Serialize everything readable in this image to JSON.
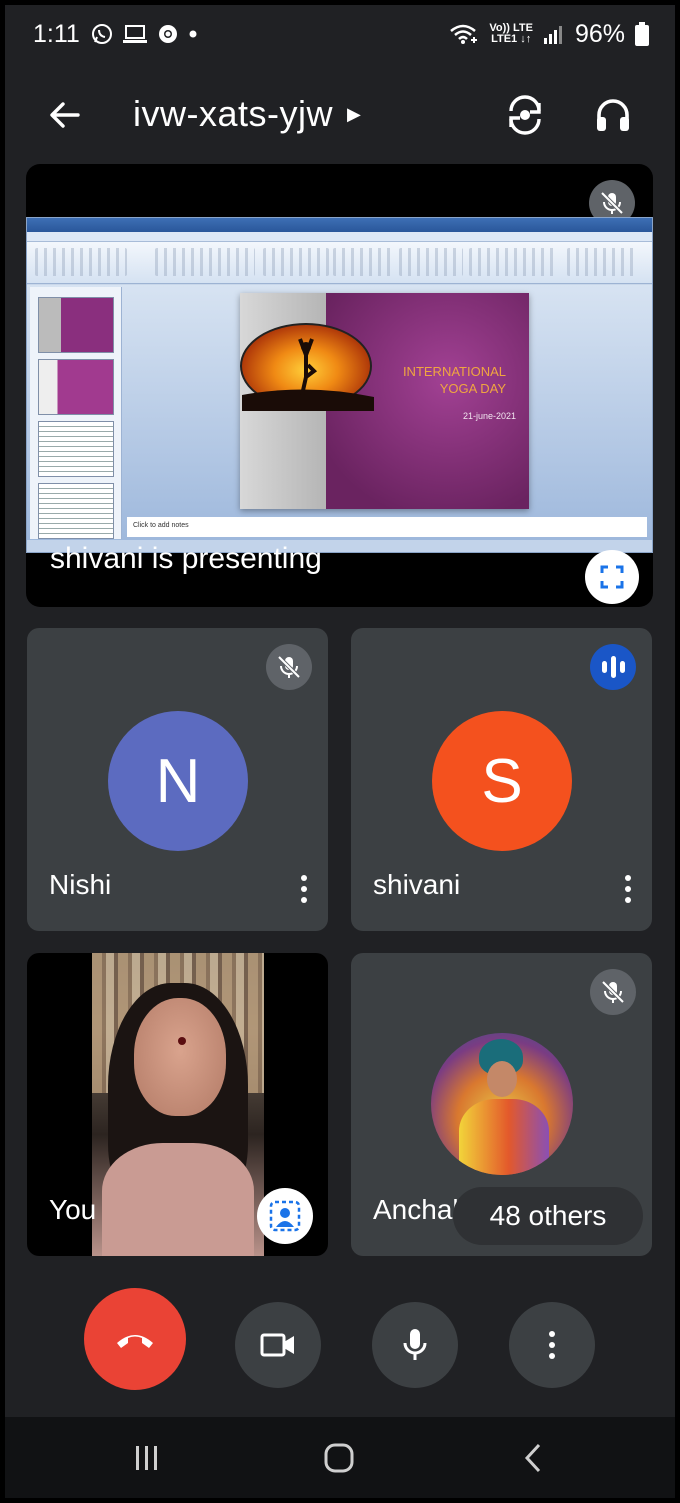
{
  "status_bar": {
    "time": "1:11",
    "network_line1": "Vo)) LTE",
    "network_line2": "LTE1 ↓↑",
    "battery": "96%"
  },
  "header": {
    "meeting_code": "ivw-xats-yjw",
    "icons": [
      "back-arrow-icon",
      "caret-right-icon",
      "switch-camera-icon",
      "headphones-icon"
    ]
  },
  "presentation": {
    "slide_title_line1": "INTERNATIONAL",
    "slide_title_line2": "YOGA DAY",
    "slide_date": "21-june-2021",
    "notes_placeholder": "Click to add notes",
    "presenting_label": "shivani is presenting"
  },
  "participants": [
    {
      "name": "Nishi",
      "initial": "N",
      "avatar_color": "#5c6bc0",
      "muted": true
    },
    {
      "name": "shivani",
      "initial": "S",
      "avatar_color": "#f4511e",
      "speaking": true
    },
    {
      "name": "You",
      "video": true
    },
    {
      "name": "Anchal",
      "photo": true,
      "muted": true
    }
  ],
  "others": {
    "label": "48 others"
  },
  "colors": {
    "background": "#202124",
    "tile": "#3c4043",
    "end_call": "#ea4335",
    "speaking_blue": "#1a56c7"
  },
  "controls": [
    "end-call-icon",
    "camera-icon",
    "microphone-icon",
    "more-options-icon"
  ],
  "navbar": [
    "recent-apps-icon",
    "home-icon",
    "back-icon"
  ]
}
